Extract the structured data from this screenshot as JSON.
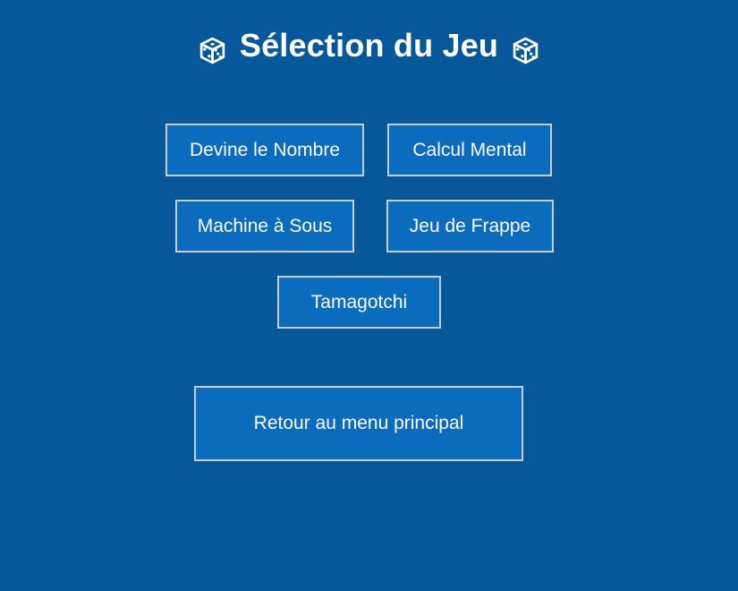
{
  "header": {
    "title": "Sélection du Jeu",
    "left_icon": "dice-icon",
    "right_icon": "dice-icon"
  },
  "games": {
    "items": [
      {
        "label": "Devine le Nombre"
      },
      {
        "label": "Calcul Mental"
      },
      {
        "label": "Machine à Sous"
      },
      {
        "label": "Jeu de Frappe"
      },
      {
        "label": "Tamagotchi"
      }
    ]
  },
  "footer": {
    "back_label": "Retour au menu principal"
  },
  "colors": {
    "background": "#07579b",
    "button": "#0b6bbd",
    "button_border": "#c8cdd3",
    "text": "#ffffff"
  }
}
